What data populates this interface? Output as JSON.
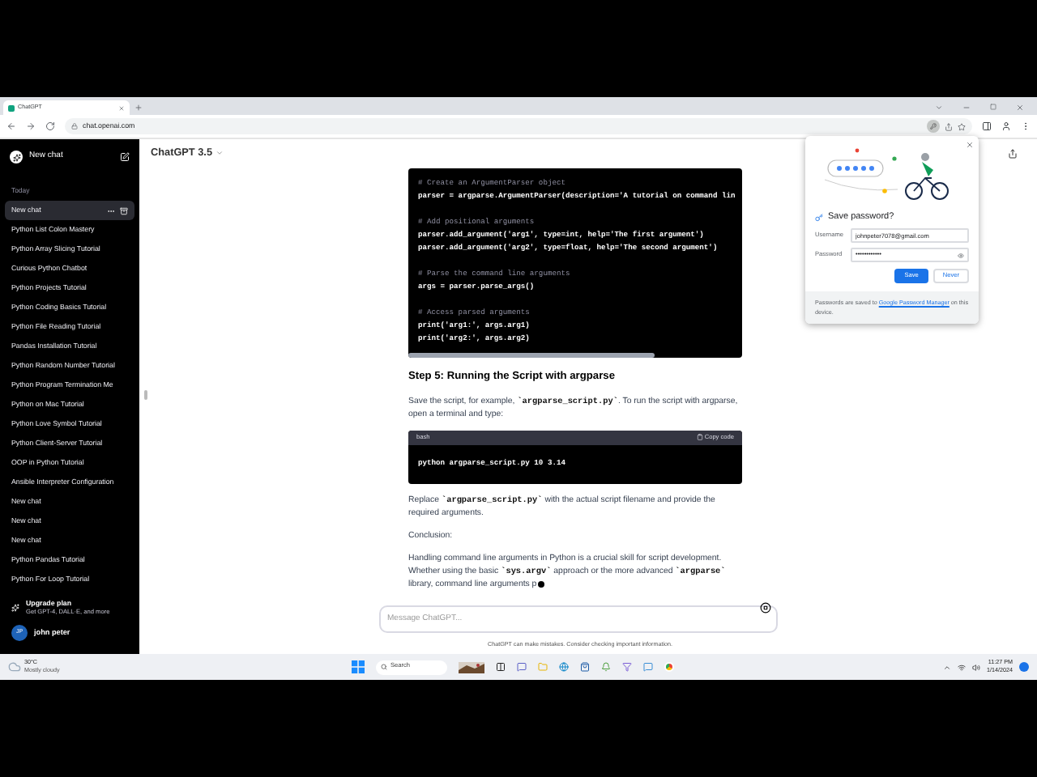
{
  "browser": {
    "tab_title": "ChatGPT",
    "url": "chat.openai.com"
  },
  "sidebar": {
    "new_chat": "New chat",
    "section": "Today",
    "items": [
      {
        "label": "New chat",
        "selected": true
      },
      {
        "label": "Python List Colon Mastery",
        "selected": false
      },
      {
        "label": "Python Array Slicing Tutorial",
        "selected": false
      },
      {
        "label": "Curious Python Chatbot",
        "selected": false
      },
      {
        "label": "Python Projects Tutorial",
        "selected": false
      },
      {
        "label": "Python Coding Basics Tutorial",
        "selected": false
      },
      {
        "label": "Python File Reading Tutorial",
        "selected": false
      },
      {
        "label": "Pandas Installation Tutorial",
        "selected": false
      },
      {
        "label": "Python Random Number Tutorial",
        "selected": false
      },
      {
        "label": "Python Program Termination Me",
        "selected": false
      },
      {
        "label": "Python on Mac Tutorial",
        "selected": false
      },
      {
        "label": "Python Love Symbol Tutorial",
        "selected": false
      },
      {
        "label": "Python Client-Server Tutorial",
        "selected": false
      },
      {
        "label": "OOP in Python Tutorial",
        "selected": false
      },
      {
        "label": "Ansible Interpreter Configuration",
        "selected": false
      },
      {
        "label": "New chat",
        "selected": false
      },
      {
        "label": "New chat",
        "selected": false
      },
      {
        "label": "New chat",
        "selected": false
      },
      {
        "label": "Python Pandas Tutorial",
        "selected": false
      },
      {
        "label": "Python For Loop Tutorial",
        "selected": false
      }
    ],
    "upgrade": {
      "title": "Upgrade plan",
      "subtitle": "Get GPT-4, DALL·E, and more"
    },
    "user": {
      "initials": "JP",
      "name": "john peter"
    }
  },
  "header": {
    "model": "ChatGPT 3.5"
  },
  "message": [
    {
      "kind": "code",
      "lines": [
        {
          "kind": "comment",
          "text": "# Create an ArgumentParser object"
        },
        {
          "kind": "code",
          "text": "parser = argparse.ArgumentParser(description='A tutorial on command lin"
        },
        {
          "kind": "blank"
        },
        {
          "kind": "comment",
          "text": "# Add positional arguments"
        },
        {
          "kind": "code",
          "text": "parser.add_argument('arg1', type=int, help='The first argument')"
        },
        {
          "kind": "code",
          "text": "parser.add_argument('arg2', type=float, help='The second argument')"
        },
        {
          "kind": "blank"
        },
        {
          "kind": "comment",
          "text": "# Parse the command line arguments"
        },
        {
          "kind": "code",
          "text": "args = parser.parse_args()"
        },
        {
          "kind": "blank"
        },
        {
          "kind": "comment",
          "text": "# Access parsed arguments"
        },
        {
          "kind": "code",
          "text": "print('arg1:', args.arg1)"
        },
        {
          "kind": "code",
          "text": "print('arg2:', args.arg2)"
        }
      ]
    },
    {
      "kind": "heading",
      "text": "Step 5: Running the Script with argparse"
    },
    {
      "kind": "paragraph",
      "parts": [
        {
          "text": "Save the script, for example, "
        },
        {
          "text": "`argparse_script.py`",
          "code": true
        },
        {
          "text": ". To run the script with argparse, open a terminal and type:"
        }
      ]
    },
    {
      "kind": "code",
      "language": "bash",
      "copy_label": "Copy code",
      "lines": [
        {
          "kind": "code",
          "text": "python argparse_script.py 10 3.14"
        }
      ]
    },
    {
      "kind": "paragraph",
      "parts": [
        {
          "text": "Replace "
        },
        {
          "text": "`argparse_script.py`",
          "code": true
        },
        {
          "text": " with the actual script filename and provide the required arguments."
        }
      ]
    },
    {
      "kind": "paragraph",
      "parts": [
        {
          "text": "Conclusion:"
        }
      ]
    },
    {
      "kind": "paragraph",
      "streaming": true,
      "parts": [
        {
          "text": "Handling command line arguments in Python is a crucial skill for script development. Whether using the basic "
        },
        {
          "text": "`sys.argv`",
          "code": true
        },
        {
          "text": " approach or the more advanced "
        },
        {
          "text": "`argparse`",
          "code": true
        },
        {
          "text": " library, command line arguments p"
        }
      ]
    }
  ],
  "composer": {
    "placeholder": "Message ChatGPT..."
  },
  "footer_note": "ChatGPT can make mistakes. Consider checking important information.",
  "password_popup": {
    "title": "Save password?",
    "username_label": "Username",
    "username": "johnpeter7078@gmail.com",
    "password_label": "Password",
    "password": "••••••••••••",
    "save": "Save",
    "never": "Never",
    "note_before": "Passwords are saved to",
    "link": "Google Password Manager",
    "note_after": "on this device."
  },
  "taskbar": {
    "temperature": "30°C",
    "weather": "Mostly cloudy",
    "search": "Search",
    "time": "11:27 PM",
    "date": "1/14/2024"
  }
}
